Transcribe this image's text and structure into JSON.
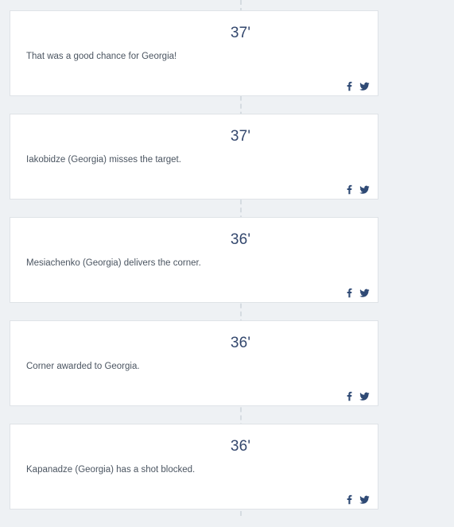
{
  "feed": {
    "events": [
      {
        "minute": "37'",
        "text": "That was a good chance for Georgia!"
      },
      {
        "minute": "37'",
        "text": "Iakobidze (Georgia) misses the target."
      },
      {
        "minute": "36'",
        "text": "Mesiachenko (Georgia) delivers the corner."
      },
      {
        "minute": "36'",
        "text": "Corner awarded to Georgia."
      },
      {
        "minute": "36'",
        "text": "Kapanadze (Georgia) has a shot blocked."
      }
    ],
    "share_icons": [
      "facebook-icon",
      "twitter-icon"
    ]
  },
  "colors": {
    "background": "#eef1f4",
    "card": "#ffffff",
    "minute_text": "#33476d",
    "body_text": "#4b5561",
    "icon": "#2f4a75"
  }
}
